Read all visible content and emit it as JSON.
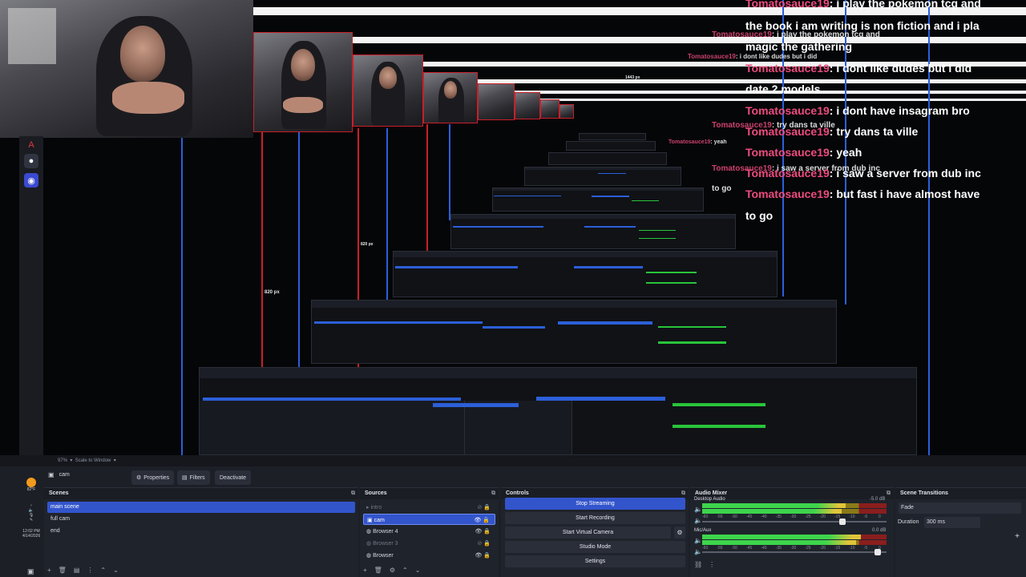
{
  "preview": {
    "pixel_labels": [
      "820 px",
      "820 px",
      "1443 px"
    ]
  },
  "chat": [
    {
      "user": "Tomatosauce19",
      "msg": "i play the pokemon tcg and"
    },
    {
      "user": "",
      "msg": "the book i am writing is non fiction and i pla"
    },
    {
      "user": "",
      "msg": "magic the gathering"
    },
    {
      "user": "Tomatosauce19",
      "msg": "i dont like dudes but i did"
    },
    {
      "user": "",
      "msg": "date 2 models"
    },
    {
      "user": "Tomatosauce19",
      "msg": "i dont have insagram bro"
    },
    {
      "user": "Tomatosauce19",
      "msg": "try dans ta ville"
    },
    {
      "user": "Tomatosauce19",
      "msg": "yeah"
    },
    {
      "user": "Tomatosauce19",
      "msg": "i saw a server from dub inc"
    },
    {
      "user": "Tomatosauce19",
      "msg": "but fast i have almost have"
    },
    {
      "user": "",
      "msg": "to go"
    }
  ],
  "topbar": {
    "zoom": "97%",
    "scale_mode": "Scale to Window"
  },
  "source_toolbar": {
    "current_source": "cam",
    "properties": "Properties",
    "filters": "Filters",
    "deactivate": "Deactivate"
  },
  "scenes": {
    "title": "Scenes",
    "items": [
      "main scene",
      "full cam",
      "end"
    ]
  },
  "sources": {
    "title": "Sources",
    "items": [
      {
        "label": "intro",
        "state": "dim"
      },
      {
        "label": "cam",
        "state": "selected"
      },
      {
        "label": "Browser 4",
        "state": "normal"
      },
      {
        "label": "Browser 3",
        "state": "dim"
      },
      {
        "label": "Browser",
        "state": "normal"
      }
    ]
  },
  "controls": {
    "title": "Controls",
    "stop_streaming": "Stop Streaming",
    "start_recording": "Start Recording",
    "start_virtual_camera": "Start Virtual Camera",
    "studio_mode": "Studio Mode",
    "settings": "Settings"
  },
  "audio_mixer": {
    "title": "Audio Mixer",
    "channels": [
      {
        "name": "Desktop Audio",
        "db": "-5.0 dB",
        "level": 0.78,
        "volume": 0.78
      },
      {
        "name": "Mic/Aux",
        "db": "0.0 dB",
        "level": 0.86,
        "volume": 0.97
      }
    ],
    "ticks": [
      "-60",
      "-55",
      "-50",
      "-45",
      "-40",
      "-35",
      "-30",
      "-25",
      "-20",
      "-15",
      "-10",
      "-5",
      "0"
    ]
  },
  "scene_transitions": {
    "title": "Scene Transitions",
    "type": "Fade",
    "duration_label": "Duration",
    "duration_value": "300 ms"
  },
  "system": {
    "weather": "82°F",
    "time": "12:02 PM",
    "date": "4/14/2026"
  },
  "colors": {
    "accent": "#3355cc",
    "chat_user": "#ec4b7e",
    "selection_border": "#c8202a"
  }
}
